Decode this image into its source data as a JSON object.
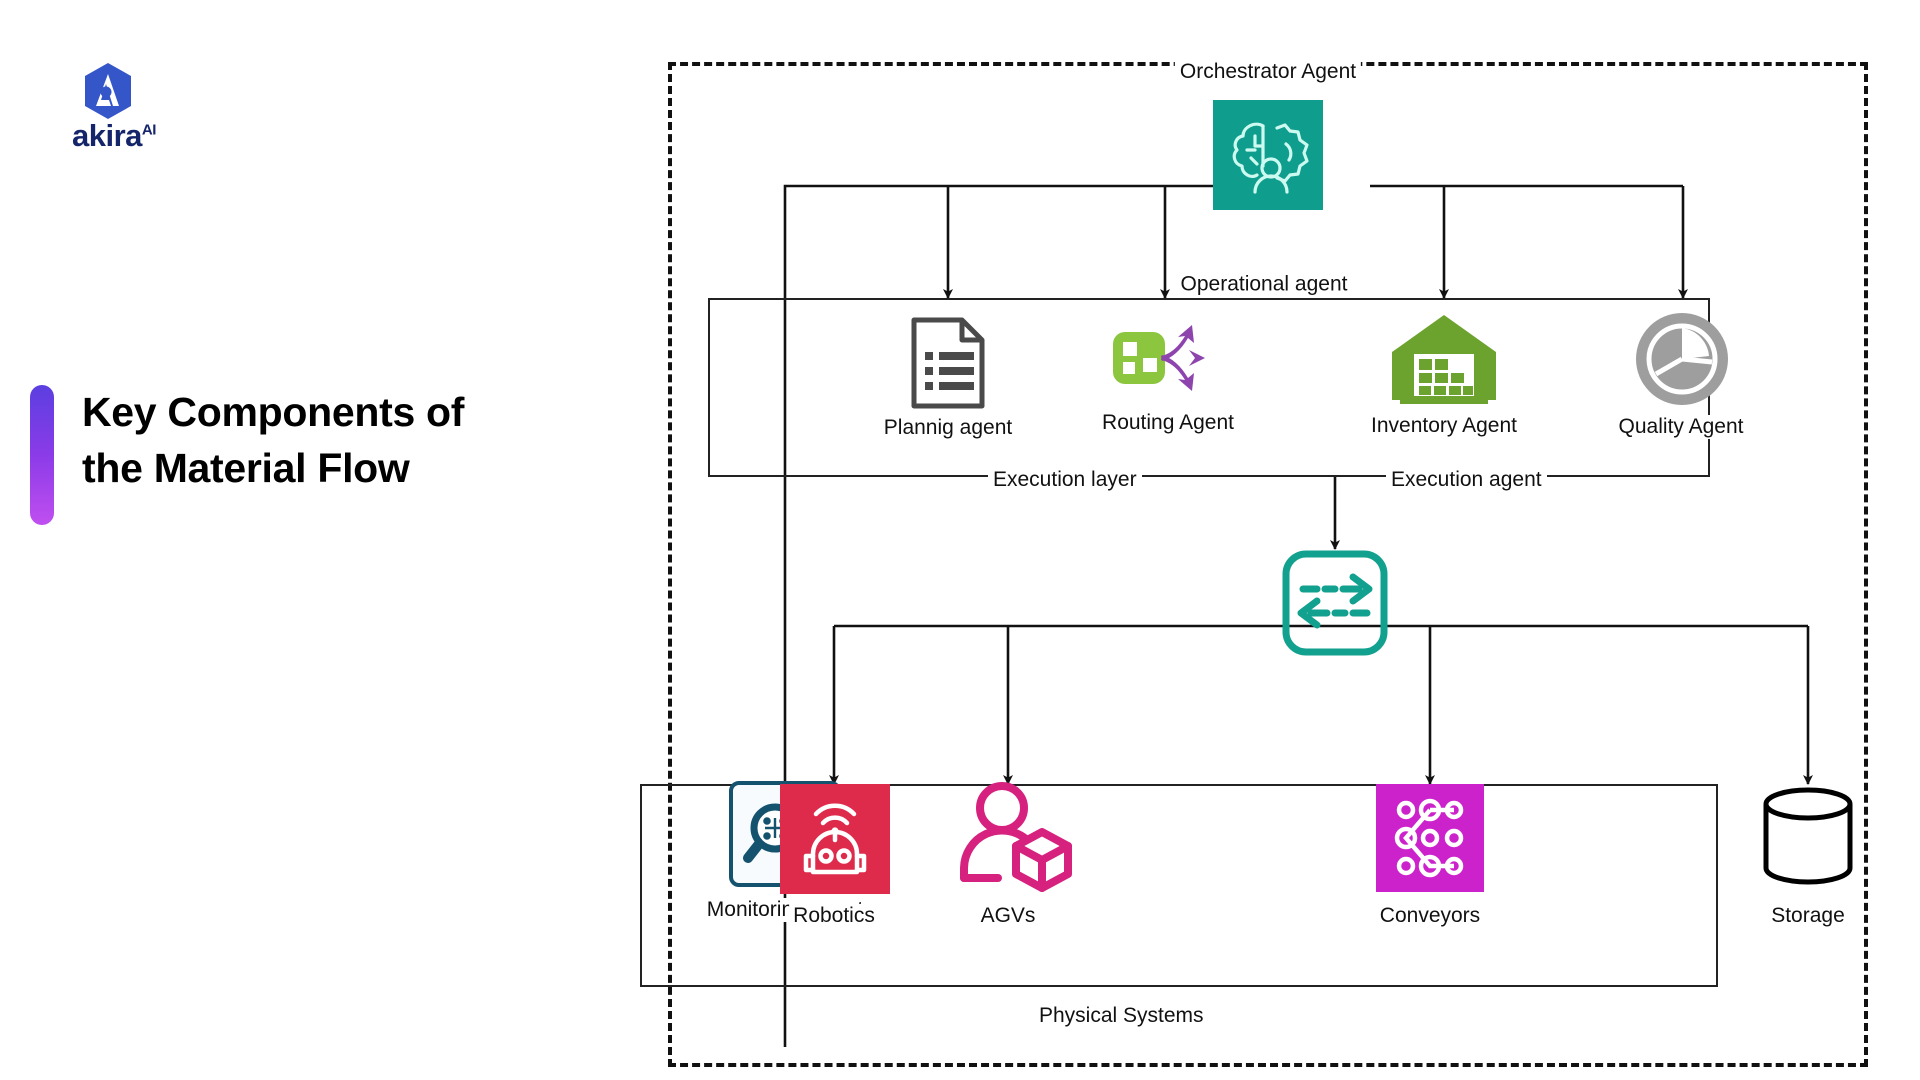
{
  "brand": {
    "logo_icon": "akira-hexagon-logo-icon",
    "wordmark": "akira",
    "superscript": "AI"
  },
  "heading": {
    "line1": "Key Components of",
    "line2": "the Material Flow",
    "accent_gradient_from": "#5b3fe0",
    "accent_gradient_to": "#c04ff0"
  },
  "diagram": {
    "boundary_style": "dashed",
    "groups": [
      {
        "id": "operational",
        "label": "Operational agent"
      },
      {
        "id": "physical",
        "label": "Physical Systems"
      }
    ],
    "orchestrator": {
      "label": "Orchestrator Agent",
      "icon": "brain-gear-person-icon",
      "color": "#0f9e8e"
    },
    "operational_agents": [
      {
        "label": "Plannig agent",
        "icon": "document-list-icon",
        "color": "#4a4a4a"
      },
      {
        "label": "Routing Agent",
        "icon": "routing-arrows-icon",
        "color": "#8e44ad"
      },
      {
        "label": "Inventory Agent",
        "icon": "warehouse-grid-icon",
        "color": "#6ca32e"
      },
      {
        "label": "Quality Agent",
        "icon": "pie-chart-icon",
        "color": "#9e9e9e"
      }
    ],
    "execution": {
      "layer_label": "Execution layer",
      "agent_label": "Execution agent",
      "icon": "exchange-arrows-icon",
      "color": "#12a18f"
    },
    "monitoring": {
      "label": "Monitoring agent",
      "icon": "magnifier-globe-icon",
      "color": "#15526e"
    },
    "physical_systems": [
      {
        "label": "Robotics",
        "icon": "robot-icon",
        "color": "#de2b4b"
      },
      {
        "label": "AGVs",
        "icon": "person-package-icon",
        "color": "#d6217f"
      },
      {
        "label": "Conveyors",
        "icon": "network-nodes-icon",
        "color": "#cc22cc"
      },
      {
        "label": "Storage",
        "icon": "database-cylinder-icon",
        "color": "#000000"
      }
    ]
  }
}
